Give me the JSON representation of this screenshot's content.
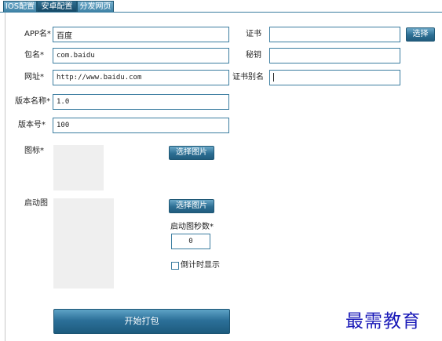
{
  "tabs": [
    {
      "label": "IOS配置",
      "active": false
    },
    {
      "label": "安卓配置",
      "active": true
    },
    {
      "label": "分发网页",
      "active": false
    }
  ],
  "form": {
    "app_name": {
      "label": "APP名*",
      "value": "百度"
    },
    "package_name": {
      "label": "包名*",
      "value": "com.baidu"
    },
    "url": {
      "label": "网址*",
      "value": "http://www.baidu.com"
    },
    "version_name": {
      "label": "版本名称*",
      "value": "1.0"
    },
    "version_code": {
      "label": "版本号*",
      "value": "100"
    },
    "certificate": {
      "label": "证书",
      "value": "",
      "button": "选择"
    },
    "secret_key": {
      "label": "秘钥",
      "value": ""
    },
    "cert_alias": {
      "label": "证书别名",
      "value": ""
    },
    "icon": {
      "label": "图标*",
      "button": "选择图片"
    },
    "splash": {
      "label": "启动图",
      "button": "选择图片",
      "seconds_label": "启动图秒数*",
      "seconds_value": "0",
      "countdown_label": "倒计时显示",
      "countdown_checked": false
    },
    "submit_button": "开始打包"
  },
  "watermark": "最需教育",
  "colors": {
    "accent": "#2c6e93",
    "border": "#3b7da0",
    "watermark": "#1a1ab8"
  }
}
